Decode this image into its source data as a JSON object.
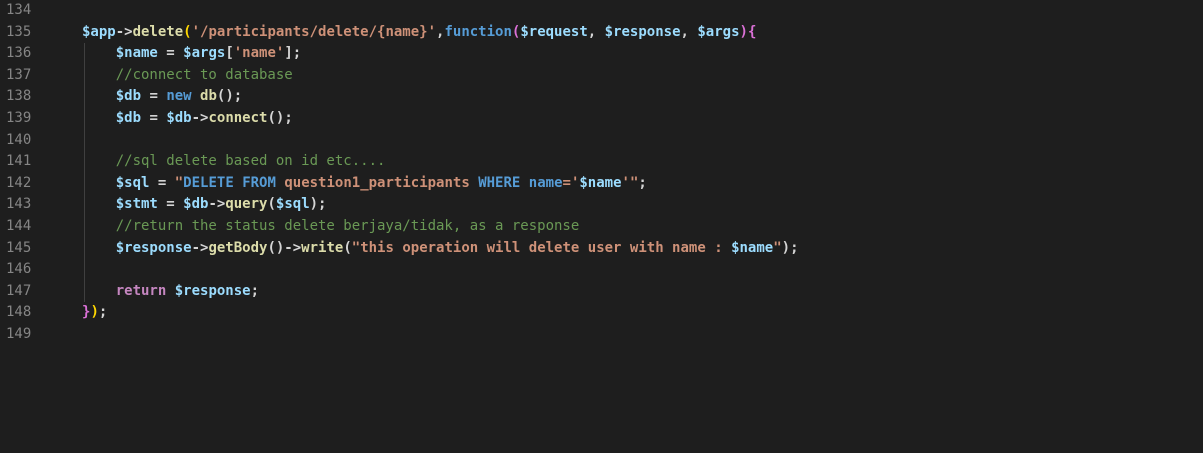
{
  "editor": {
    "colors": {
      "background": "#1e1e1e",
      "line_number": "#858585",
      "variable": "#9cdcfe",
      "string": "#ce9178",
      "keyword": "#569cd6",
      "function": "#dcdcaa",
      "comment": "#6a9955"
    },
    "lines": [
      {
        "num": "134",
        "indent": false,
        "tokens": []
      },
      {
        "num": "135",
        "indent": false,
        "tokens": [
          {
            "t": "$app",
            "c": "var"
          },
          {
            "t": "->",
            "c": "plain"
          },
          {
            "t": "delete",
            "c": "fn"
          },
          {
            "t": "(",
            "c": "brace"
          },
          {
            "t": "'/participants/delete/{name}'",
            "c": "str"
          },
          {
            "t": ",",
            "c": "plain"
          },
          {
            "t": "function",
            "c": "kw"
          },
          {
            "t": "(",
            "c": "brace2"
          },
          {
            "t": "$request",
            "c": "var"
          },
          {
            "t": ", ",
            "c": "plain"
          },
          {
            "t": "$response",
            "c": "var"
          },
          {
            "t": ", ",
            "c": "plain"
          },
          {
            "t": "$args",
            "c": "var"
          },
          {
            "t": ")",
            "c": "brace2"
          },
          {
            "t": "{",
            "c": "brace2"
          }
        ]
      },
      {
        "num": "136",
        "indent": true,
        "tokens": [
          {
            "t": "    $name",
            "c": "var"
          },
          {
            "t": " = ",
            "c": "plain"
          },
          {
            "t": "$args",
            "c": "var"
          },
          {
            "t": "[",
            "c": "plain"
          },
          {
            "t": "'name'",
            "c": "str"
          },
          {
            "t": "];",
            "c": "plain"
          }
        ]
      },
      {
        "num": "137",
        "indent": true,
        "tokens": [
          {
            "t": "    //connect to database",
            "c": "cmt"
          }
        ]
      },
      {
        "num": "138",
        "indent": true,
        "tokens": [
          {
            "t": "    $db",
            "c": "var"
          },
          {
            "t": " = ",
            "c": "plain"
          },
          {
            "t": "new",
            "c": "kw"
          },
          {
            "t": " ",
            "c": "plain"
          },
          {
            "t": "db",
            "c": "fn"
          },
          {
            "t": "();",
            "c": "plain"
          }
        ]
      },
      {
        "num": "139",
        "indent": true,
        "tokens": [
          {
            "t": "    $db",
            "c": "var"
          },
          {
            "t": " = ",
            "c": "plain"
          },
          {
            "t": "$db",
            "c": "var"
          },
          {
            "t": "->",
            "c": "plain"
          },
          {
            "t": "connect",
            "c": "fn"
          },
          {
            "t": "();",
            "c": "plain"
          }
        ]
      },
      {
        "num": "140",
        "indent": true,
        "tokens": []
      },
      {
        "num": "141",
        "indent": true,
        "tokens": [
          {
            "t": "    //sql delete based on id etc....",
            "c": "cmt"
          }
        ]
      },
      {
        "num": "142",
        "indent": true,
        "tokens": [
          {
            "t": "    $sql",
            "c": "var"
          },
          {
            "t": " = ",
            "c": "plain"
          },
          {
            "t": "\"",
            "c": "str"
          },
          {
            "t": "DELETE",
            "c": "kw"
          },
          {
            "t": " ",
            "c": "str"
          },
          {
            "t": "FROM",
            "c": "kw"
          },
          {
            "t": " question1_participants ",
            "c": "str"
          },
          {
            "t": "WHERE",
            "c": "kw"
          },
          {
            "t": " ",
            "c": "str"
          },
          {
            "t": "name",
            "c": "kw"
          },
          {
            "t": "='",
            "c": "str"
          },
          {
            "t": "$name",
            "c": "var"
          },
          {
            "t": "'\"",
            "c": "str"
          },
          {
            "t": ";",
            "c": "plain"
          }
        ]
      },
      {
        "num": "143",
        "indent": true,
        "tokens": [
          {
            "t": "    $stmt",
            "c": "var"
          },
          {
            "t": " = ",
            "c": "plain"
          },
          {
            "t": "$db",
            "c": "var"
          },
          {
            "t": "->",
            "c": "plain"
          },
          {
            "t": "query",
            "c": "fn"
          },
          {
            "t": "(",
            "c": "plain"
          },
          {
            "t": "$sql",
            "c": "var"
          },
          {
            "t": ");",
            "c": "plain"
          }
        ]
      },
      {
        "num": "144",
        "indent": true,
        "tokens": [
          {
            "t": "    //return the status delete berjaya/tidak, as a response",
            "c": "cmt"
          }
        ]
      },
      {
        "num": "145",
        "indent": true,
        "tokens": [
          {
            "t": "    $response",
            "c": "var"
          },
          {
            "t": "->",
            "c": "plain"
          },
          {
            "t": "getBody",
            "c": "fn"
          },
          {
            "t": "()->",
            "c": "plain"
          },
          {
            "t": "write",
            "c": "fn"
          },
          {
            "t": "(",
            "c": "plain"
          },
          {
            "t": "\"this operation will delete user with name : ",
            "c": "str"
          },
          {
            "t": "$name",
            "c": "var"
          },
          {
            "t": "\"",
            "c": "str"
          },
          {
            "t": ");",
            "c": "plain"
          }
        ]
      },
      {
        "num": "146",
        "indent": true,
        "tokens": []
      },
      {
        "num": "147",
        "indent": true,
        "tokens": [
          {
            "t": "    ",
            "c": "plain"
          },
          {
            "t": "return",
            "c": "ret"
          },
          {
            "t": " ",
            "c": "plain"
          },
          {
            "t": "$response",
            "c": "var"
          },
          {
            "t": ";",
            "c": "plain"
          }
        ]
      },
      {
        "num": "148",
        "indent": false,
        "tokens": [
          {
            "t": "}",
            "c": "brace2"
          },
          {
            "t": ")",
            "c": "brace"
          },
          {
            "t": ";",
            "c": "plain"
          }
        ]
      },
      {
        "num": "149",
        "indent": false,
        "tokens": []
      }
    ]
  }
}
